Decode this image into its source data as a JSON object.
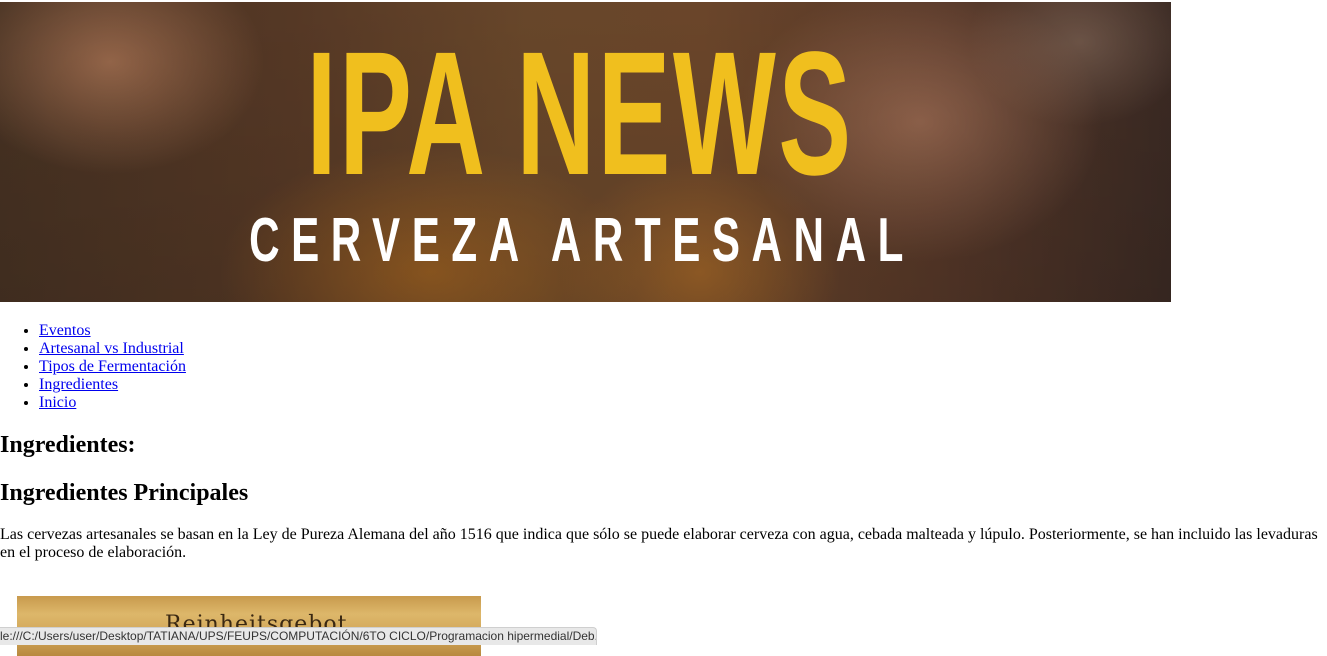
{
  "banner": {
    "title": "IPA NEWS",
    "subtitle": "CERVEZA ARTESANAL",
    "title_color": "#f0bf1e",
    "subtitle_color": "#ffffff"
  },
  "nav": {
    "items": [
      {
        "label": "Eventos"
      },
      {
        "label": "Artesanal vs Industrial"
      },
      {
        "label": "Tipos de Fermentación"
      },
      {
        "label": "Ingredientes"
      },
      {
        "label": "Inicio"
      }
    ],
    "link_color": "#0000ee"
  },
  "main": {
    "heading": "Ingredientes:",
    "subheading": "Ingredientes Principales",
    "paragraph": "Las cervezas artesanales se basan en la Ley de Pureza Alemana del año 1516 que indica que sólo se puede elaborar cerveza con agua, cebada malteada y lúpulo. Posteriormente, se han incluido las levaduras en el proceso de elaboración.",
    "image_text": "Reinheitsgebot"
  },
  "status_bar": {
    "url": "le:///C:/Users/user/Desktop/TATIANA/UPS/FEUPS/COMPUTACIÓN/6TO CICLO/Programacion hipermedial/Deb..."
  }
}
